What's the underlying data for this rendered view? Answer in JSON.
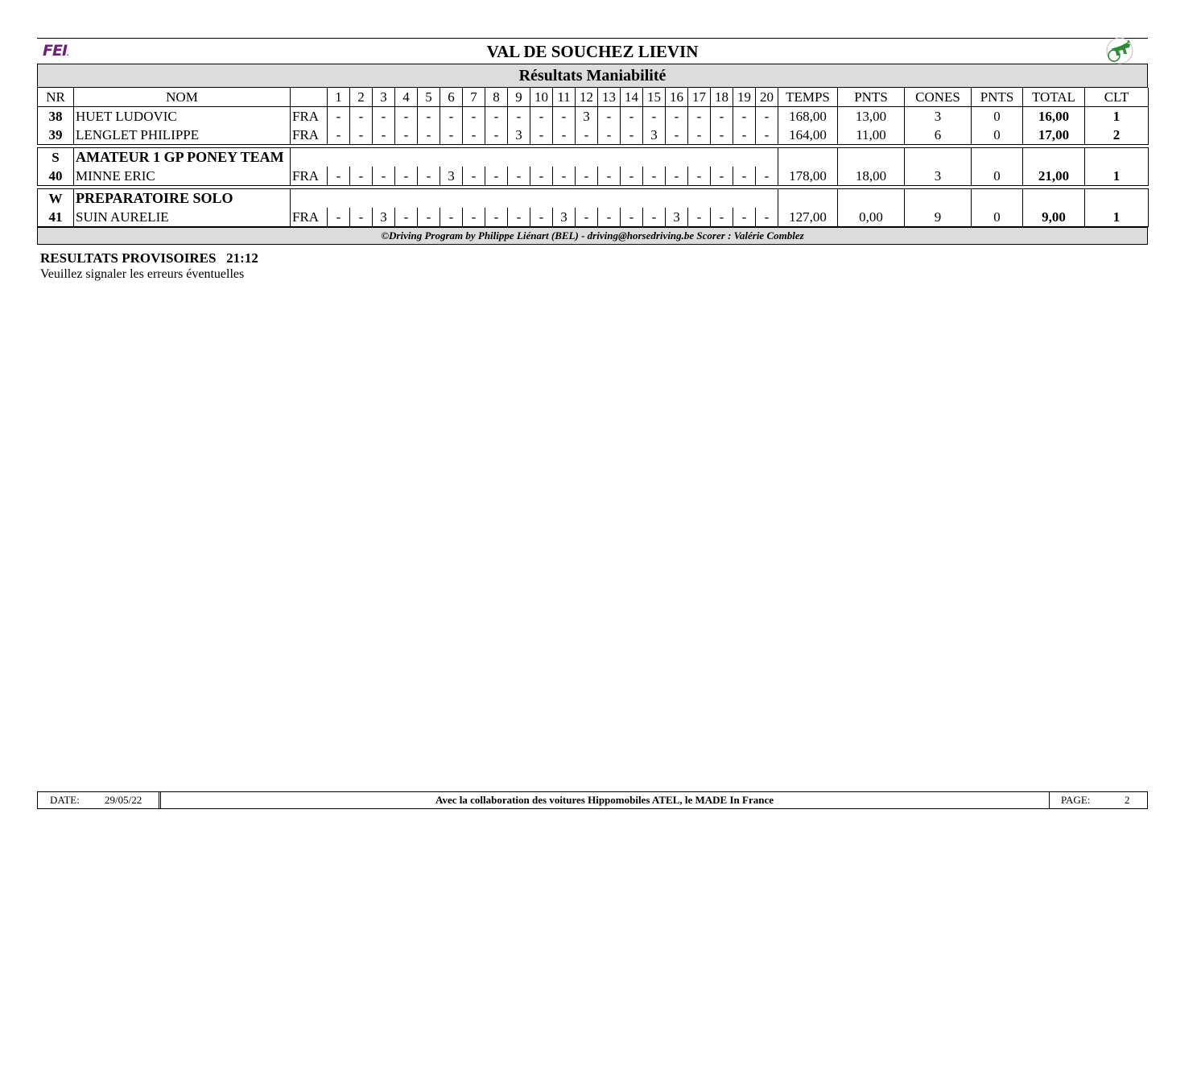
{
  "header": {
    "logo_text": "FEI",
    "title": "VAL DE SOUCHEZ LIEVIN",
    "subtitle": "Résultats Maniabilité"
  },
  "columns": {
    "nr": "NR",
    "nom": "NOM",
    "obstacles": [
      "1",
      "2",
      "3",
      "4",
      "5",
      "6",
      "7",
      "8",
      "9",
      "10",
      "11",
      "12",
      "13",
      "14",
      "15",
      "16",
      "17",
      "18",
      "19",
      "20"
    ],
    "temps": "TEMPS",
    "pnts1": "PNTS",
    "cones": "CONES",
    "pnts2": "PNTS",
    "total": "TOTAL",
    "clt": "CLT"
  },
  "groups": [
    {
      "code": "",
      "category": "",
      "rows": [
        {
          "nr": "38",
          "nom": "HUET LUDOVIC",
          "nat": "FRA",
          "obs": [
            "-",
            "-",
            "-",
            "-",
            "-",
            "-",
            "-",
            "-",
            "-",
            "-",
            "-",
            "3",
            "-",
            "-",
            "-",
            "-",
            "-",
            "-",
            "-",
            "-"
          ],
          "temps": "168,00",
          "pnts1": "13,00",
          "cones": "3",
          "pnts2": "0",
          "total": "16,00",
          "clt": "1"
        },
        {
          "nr": "39",
          "nom": "LENGLET PHILIPPE",
          "nat": "FRA",
          "obs": [
            "-",
            "-",
            "-",
            "-",
            "-",
            "-",
            "-",
            "-",
            "3",
            "-",
            "-",
            "-",
            "-",
            "-",
            "3",
            "-",
            "-",
            "-",
            "-",
            "-"
          ],
          "temps": "164,00",
          "pnts1": "11,00",
          "cones": "6",
          "pnts2": "0",
          "total": "17,00",
          "clt": "2"
        }
      ]
    },
    {
      "code": "S",
      "category": "AMATEUR 1 GP PONEY TEAM",
      "rows": [
        {
          "nr": "40",
          "nom": "MINNE ERIC",
          "nat": "FRA",
          "obs": [
            "-",
            "-",
            "-",
            "-",
            "-",
            "3",
            "-",
            "-",
            "-",
            "-",
            "-",
            "-",
            "-",
            "-",
            "-",
            "-",
            "-",
            "-",
            "-",
            "-"
          ],
          "temps": "178,00",
          "pnts1": "18,00",
          "cones": "3",
          "pnts2": "0",
          "total": "21,00",
          "clt": "1"
        }
      ]
    },
    {
      "code": "W",
      "category": "PREPARATOIRE SOLO",
      "rows": [
        {
          "nr": "41",
          "nom": "SUIN AURELIE",
          "nat": "FRA",
          "obs": [
            "-",
            "-",
            "3",
            "-",
            "-",
            "-",
            "-",
            "-",
            "-",
            "-",
            "3",
            "-",
            "-",
            "-",
            "-",
            "3",
            "-",
            "-",
            "-",
            "-"
          ],
          "temps": "127,00",
          "pnts1": "0,00",
          "cones": "9",
          "pnts2": "0",
          "total": "9,00",
          "clt": "1"
        }
      ]
    }
  ],
  "footer_line": "©Driving Program by Philippe Liénart (BEL) - driving@horsedriving.be    Scorer : Valérie Comblez",
  "provisional": "RESULTATS PROVISOIRES   21:12",
  "note": "Veuillez signaler les erreurs éventuelles",
  "bottom": {
    "date_label": "DATE:",
    "date_value": "29/05/22",
    "collab": "Avec la collaboration des voitures Hippomobiles ATEL, le MADE In France",
    "page_label": "PAGE:",
    "page_value": "2"
  }
}
